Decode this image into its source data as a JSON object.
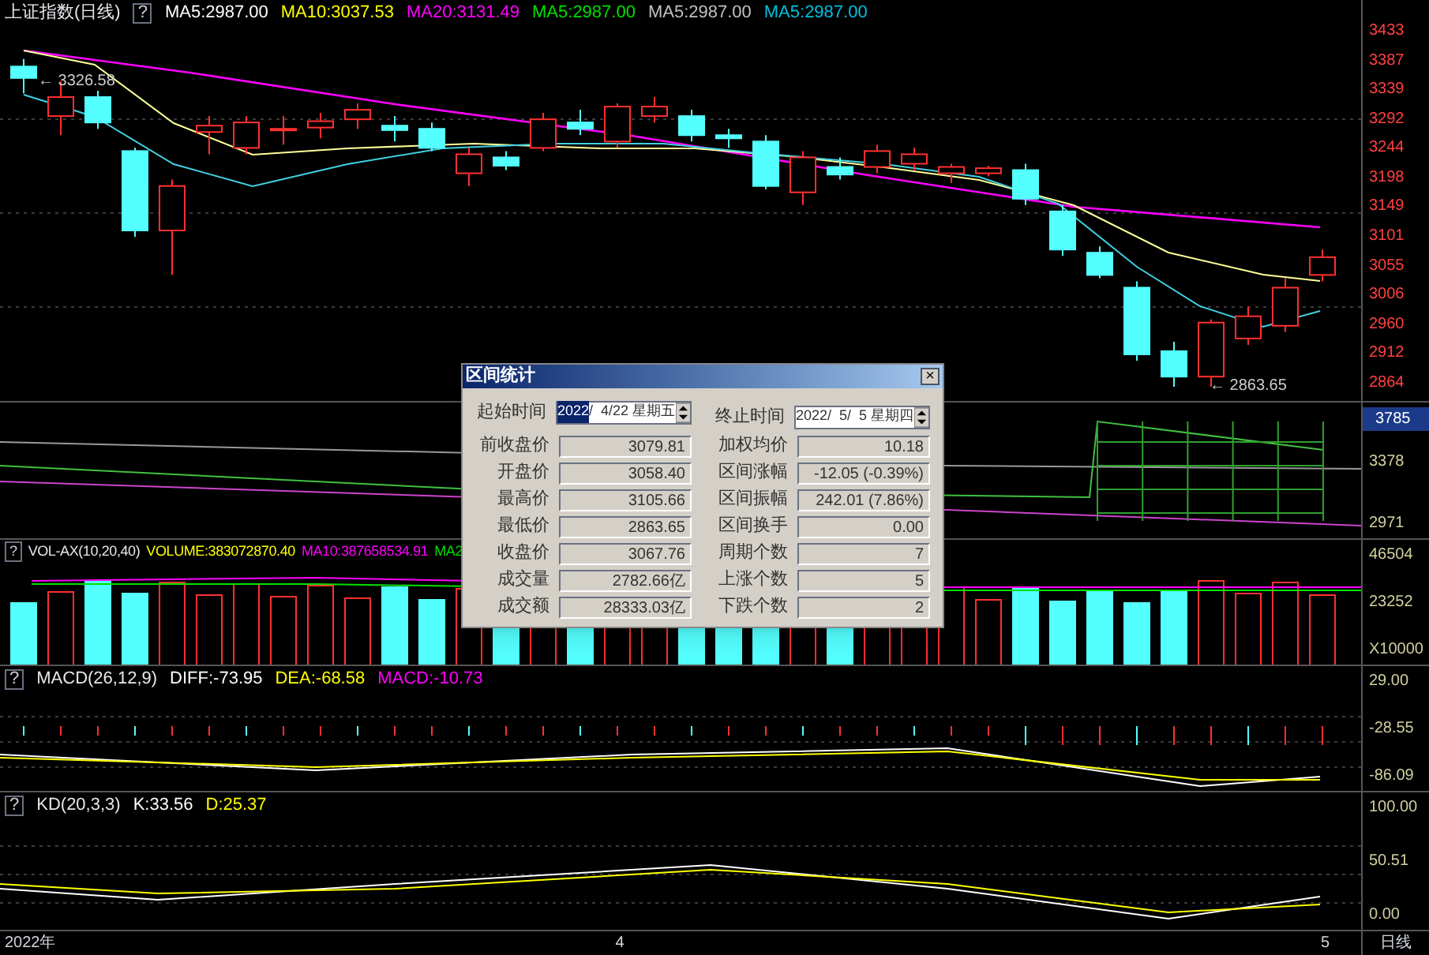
{
  "price_pane": {
    "title": "上证指数(日线)",
    "help": "?",
    "indicators": [
      {
        "text": "MA5:2987.00",
        "color": "#ffffff"
      },
      {
        "text": "MA10:3037.53",
        "color": "#ffff00"
      },
      {
        "text": "MA20:3131.49",
        "color": "#ff00ff"
      },
      {
        "text": "MA5:2987.00",
        "color": "#00e000"
      },
      {
        "text": "MA5:2987.00",
        "color": "#c0c0c0"
      },
      {
        "text": "MA5:2987.00",
        "color": "#00c0e0"
      }
    ],
    "high_marker": "← 3326.58",
    "low_marker": "← 2863.65",
    "axis_labels": [
      "3433",
      "3387",
      "3339",
      "3292",
      "3244",
      "3198",
      "3149",
      "3101",
      "3055",
      "3006",
      "2960",
      "2912",
      "2864"
    ]
  },
  "overlay_pane": {
    "axis_labels": [
      "3378",
      "2971"
    ],
    "current_value": "3785"
  },
  "volume_pane": {
    "help": "?",
    "title": "VOL-AX(10,20,40)",
    "indicators": [
      {
        "text": "VOLUME:383072870.40",
        "color": "#ffff00"
      },
      {
        "text": "MA10:387658534.91",
        "color": "#ff00ff"
      },
      {
        "text": "MA2",
        "color": "#00e000"
      }
    ],
    "axis_labels": [
      "46504",
      "23252",
      "X10000"
    ]
  },
  "macd_pane": {
    "help": "?",
    "title": "MACD(26,12,9)",
    "indicators": [
      {
        "text": "DIFF:-73.95",
        "color": "#ffffff"
      },
      {
        "text": "DEA:-68.58",
        "color": "#ffff00"
      },
      {
        "text": "MACD:-10.73",
        "color": "#ff00ff"
      }
    ],
    "axis_labels": [
      "29.00",
      "-28.55",
      "-86.09"
    ]
  },
  "kd_pane": {
    "help": "?",
    "title": "KD(20,3,3)",
    "indicators": [
      {
        "text": "K:33.56",
        "color": "#ffffff"
      },
      {
        "text": "D:25.37",
        "color": "#ffff00"
      }
    ],
    "axis_labels": [
      "100.00",
      "50.51",
      "0.00"
    ]
  },
  "time_axis": {
    "labels": [
      "2022年",
      "4",
      "5"
    ],
    "period": "日线"
  },
  "dialog": {
    "title": "区间统计",
    "close": "×",
    "start": {
      "label": "起始时间",
      "year": "2022",
      "rest": "/  4/22 星期五"
    },
    "end": {
      "label": "终止时间",
      "value": "2022/  5/  5 星期四"
    },
    "left": [
      {
        "label": "前收盘价",
        "value": "3079.81"
      },
      {
        "label": "开盘价",
        "value": "3058.40"
      },
      {
        "label": "最高价",
        "value": "3105.66"
      },
      {
        "label": "最低价",
        "value": "2863.65"
      },
      {
        "label": "收盘价",
        "value": "3067.76"
      },
      {
        "label": "成交量",
        "value": "2782.66亿"
      },
      {
        "label": "成交额",
        "value": "28333.03亿"
      }
    ],
    "right": [
      {
        "label": "加权均价",
        "value": "10.18"
      },
      {
        "label": "区间涨幅",
        "value": "-12.05 (-0.39%)"
      },
      {
        "label": "区间振幅",
        "value": "242.01 (7.86%)"
      },
      {
        "label": "区间换手",
        "value": "0.00"
      },
      {
        "label": "周期个数",
        "value": "7"
      },
      {
        "label": "上涨个数",
        "value": "5"
      },
      {
        "label": "下跌个数",
        "value": "2"
      }
    ]
  }
}
